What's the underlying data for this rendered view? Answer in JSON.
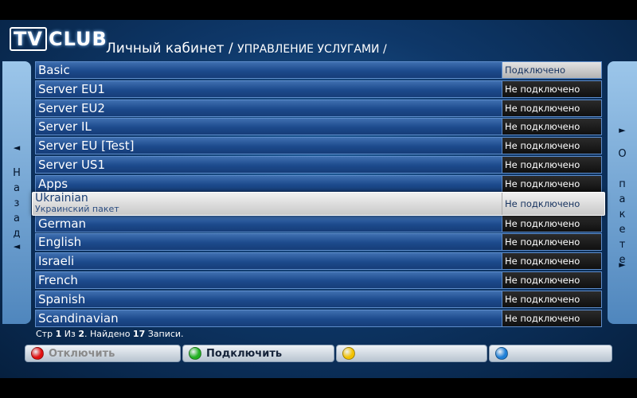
{
  "header": {
    "logo_tv": "TV",
    "logo_club": "CLUB",
    "crumb_main": "Личный кабинет / ",
    "crumb_sub": "УПРАВЛЕНИЕ УСЛУГАМИ /"
  },
  "left_panel": {
    "arrow_up": "◄",
    "letters": [
      "Н",
      "а",
      "з",
      "а",
      "д"
    ],
    "arrow_down": "◄"
  },
  "right_panel": {
    "arrow_up": "►",
    "letters": [
      "О",
      "",
      "п",
      "а",
      "к",
      "е",
      "т",
      "е"
    ],
    "arrow_down": "►"
  },
  "rows": [
    {
      "name": "Basic",
      "status": "Подключено"
    },
    {
      "name": "Server EU1",
      "status": "Не подключено"
    },
    {
      "name": "Server EU2",
      "status": "Не подключено"
    },
    {
      "name": "Server IL",
      "status": "Не подключено"
    },
    {
      "name": "Server EU [Test]",
      "status": "Не подключено"
    },
    {
      "name": "Server US1",
      "status": "Не подключено"
    },
    {
      "name": "Apps",
      "status": "Не подключено"
    },
    {
      "name": "Ukrainian",
      "sub": "Украинский пакет",
      "status": "Не подключено"
    },
    {
      "name": "German",
      "status": "Не подключено"
    },
    {
      "name": "English",
      "status": "Не подключено"
    },
    {
      "name": "Israeli",
      "status": "Не подключено"
    },
    {
      "name": "French",
      "status": "Не подключено"
    },
    {
      "name": "Spanish",
      "status": "Не подключено"
    },
    {
      "name": "Scandinavian",
      "status": "Не подключено"
    }
  ],
  "footer": {
    "prefix": "Стр ",
    "page": "1",
    "of": " Из ",
    "total_pages": "2",
    "found": ". Найдено ",
    "count": "17",
    "suffix": " Записи."
  },
  "buttons": {
    "red_label": "Отключить",
    "green_label": "Подключить",
    "yellow_label": "",
    "blue_label": ""
  },
  "colors": {
    "red": "#e01010",
    "green": "#22b022",
    "yellow": "#f2c200",
    "blue": "#1f7fd6"
  }
}
